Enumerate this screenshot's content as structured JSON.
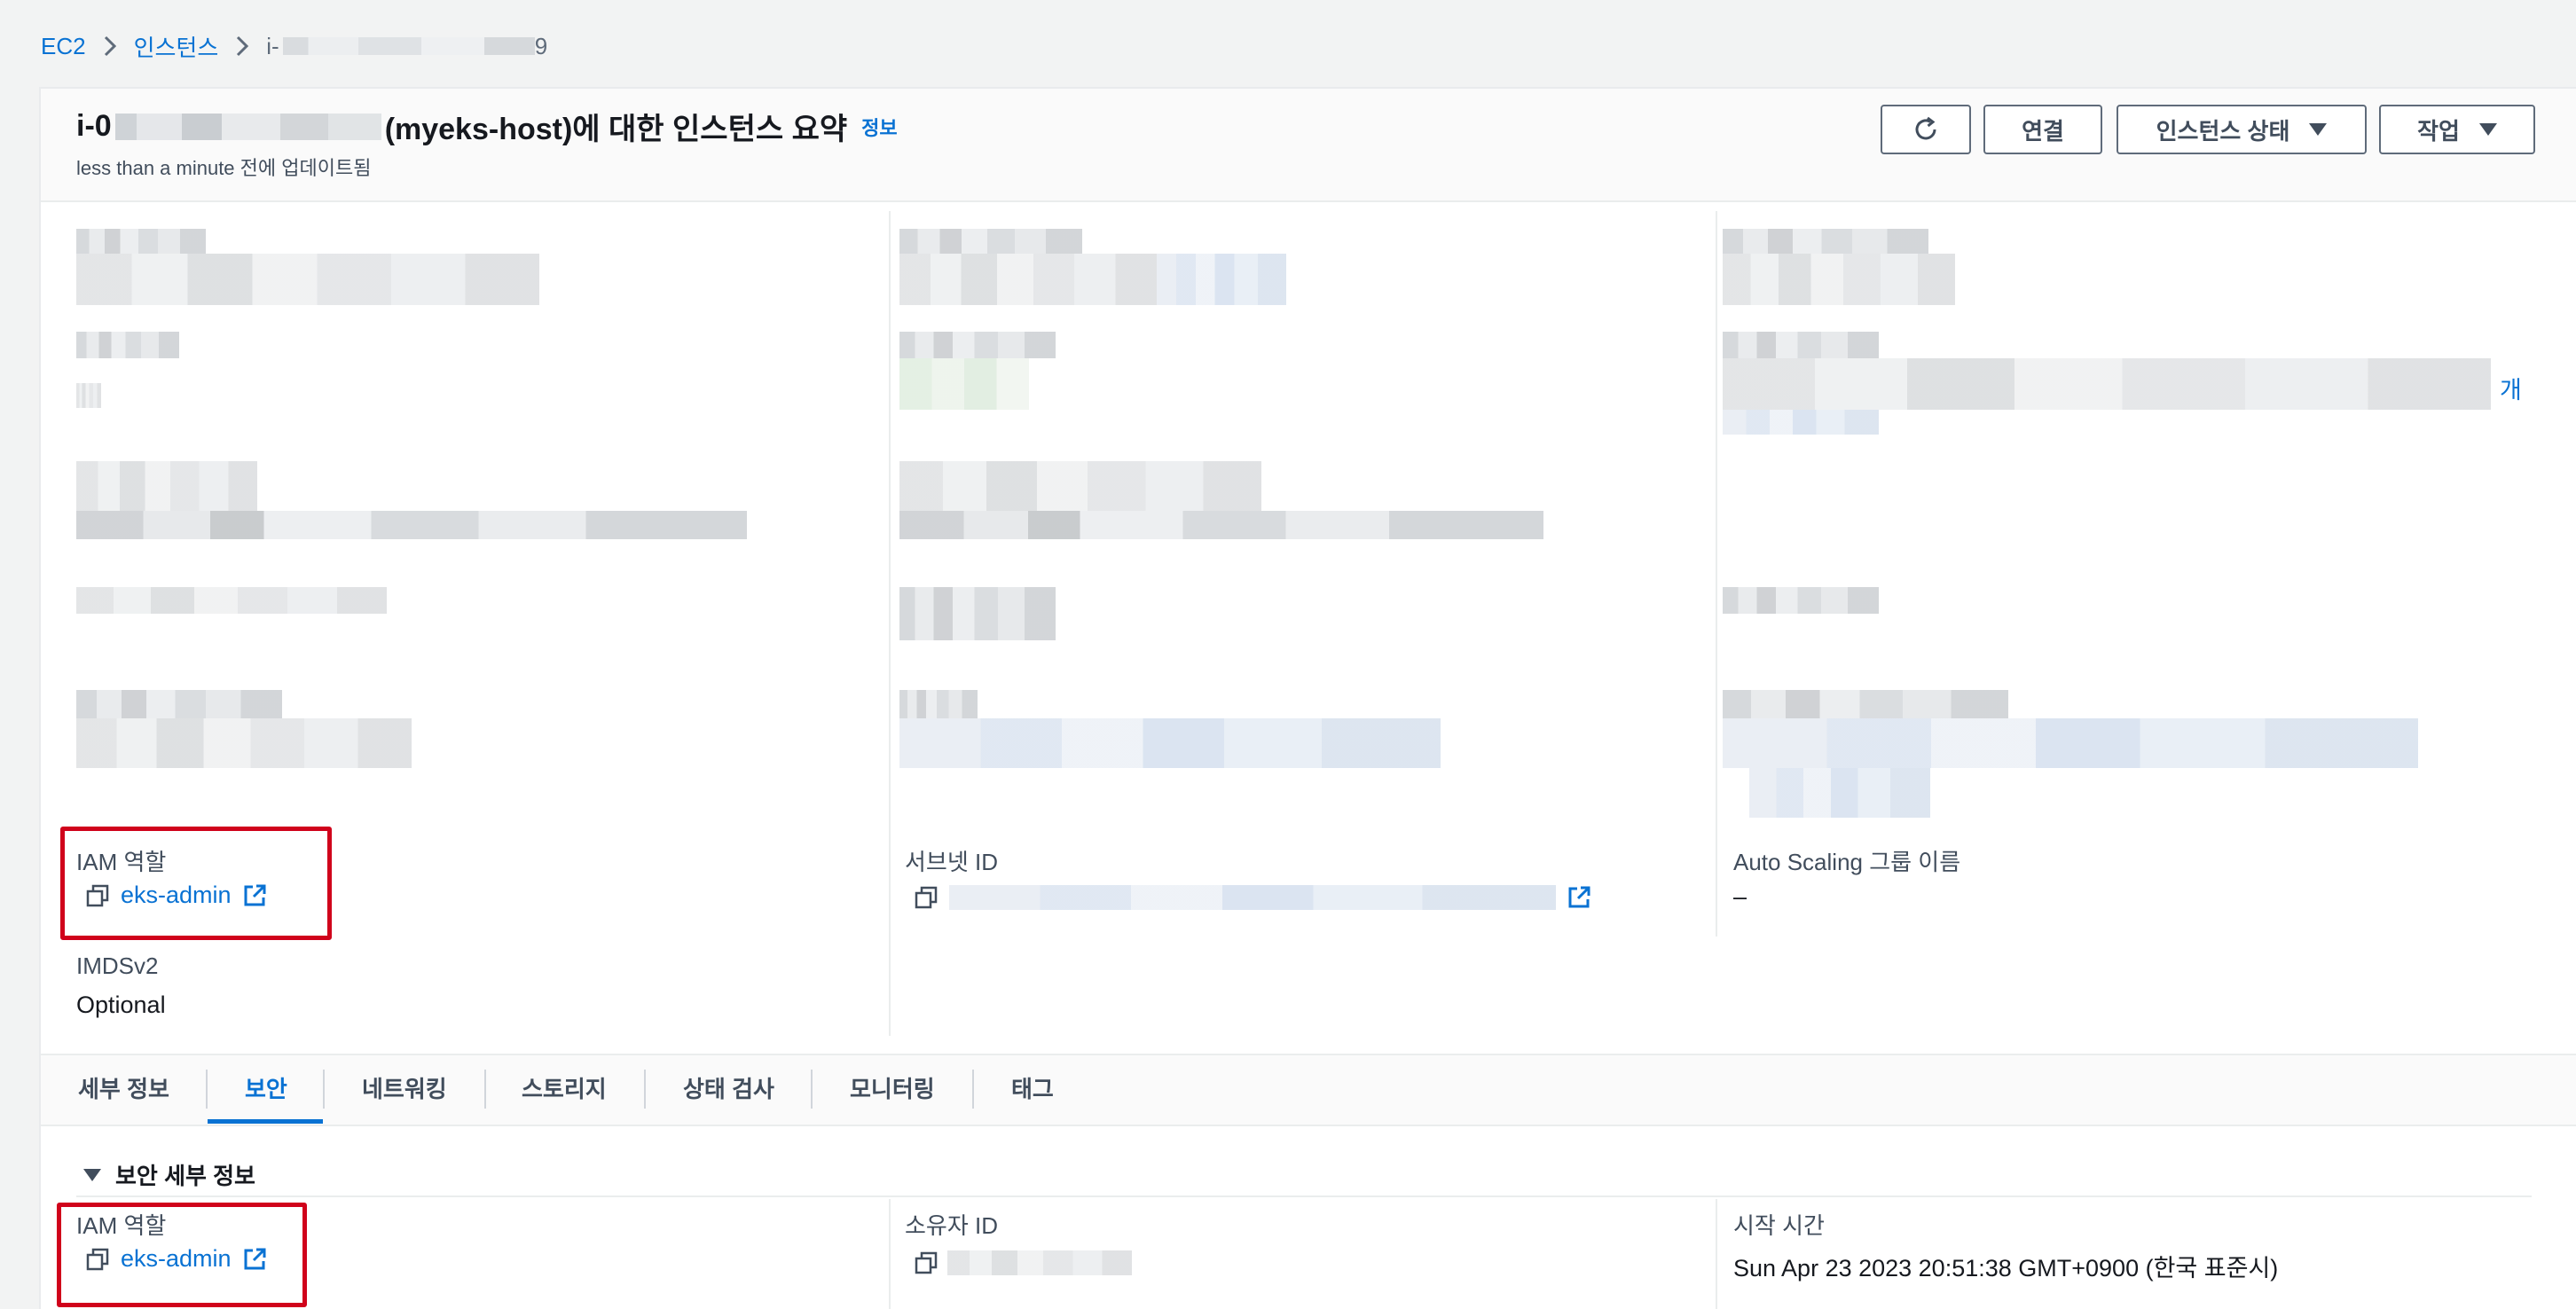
{
  "breadcrumb": {
    "root": "EC2",
    "parent": "인스턴스",
    "current_prefix": "i-",
    "current_suffix": "9"
  },
  "header": {
    "title_prefix": "i-0",
    "title_suffix": " (myeks-host)에 대한 인스턴스 요약",
    "info_link": "정보",
    "subtitle": "less than a minute 전에 업데이트됨",
    "buttons": {
      "connect": "연결",
      "instance_state": "인스턴스 상태",
      "actions": "작업"
    }
  },
  "summary": {
    "more_link_fragment": "개",
    "iam_role_label": "IAM 역할",
    "iam_role_value": "eks-admin",
    "subnet_label": "서브넷 ID",
    "asg_label": "Auto Scaling 그룹 이름",
    "asg_value": "–",
    "imdsv2_label": "IMDSv2",
    "imdsv2_value": "Optional"
  },
  "tabs": [
    {
      "label": "세부 정보"
    },
    {
      "label": "보안"
    },
    {
      "label": "네트워킹"
    },
    {
      "label": "스토리지"
    },
    {
      "label": "상태 검사"
    },
    {
      "label": "모니터링"
    },
    {
      "label": "태그"
    }
  ],
  "security": {
    "section_title": "보안 세부 정보",
    "iam_role_label": "IAM 역할",
    "iam_role_value": "eks-admin",
    "owner_label": "소유자 ID",
    "launch_time_label": "시작 시간",
    "launch_time_value": "Sun Apr 23 2023 20:51:38 GMT+0900 (한국 표준시)"
  },
  "colors": {
    "link": "#0972d3",
    "highlight_box": "#d0021b",
    "text": "#16191f",
    "secondary_text": "#414d5c"
  }
}
